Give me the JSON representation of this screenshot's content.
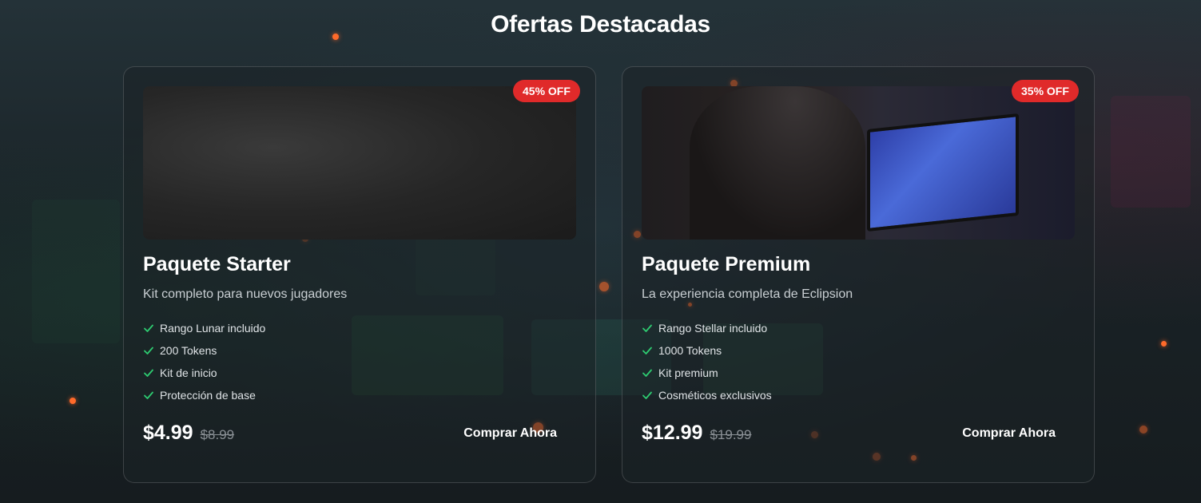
{
  "section": {
    "title": "Ofertas Destacadas"
  },
  "colors": {
    "accent_red": "#e02a2a",
    "check_green": "#2ecc71",
    "particle_orange": "#ff6a2a"
  },
  "offers": [
    {
      "badge": "45% OFF",
      "title": "Paquete Starter",
      "description": "Kit completo para nuevos jugadores",
      "features": [
        "Rango Lunar incluido",
        "200 Tokens",
        "Kit de inicio",
        "Protección de base"
      ],
      "price": "$4.99",
      "old_price": "$8.99",
      "button": "Comprar Ahora"
    },
    {
      "badge": "35% OFF",
      "title": "Paquete Premium",
      "description": "La experiencia completa de Eclipsion",
      "features": [
        "Rango Stellar incluido",
        "1000 Tokens",
        "Kit premium",
        "Cosméticos exclusivos"
      ],
      "price": "$12.99",
      "old_price": "$19.99",
      "button": "Comprar Ahora"
    }
  ]
}
